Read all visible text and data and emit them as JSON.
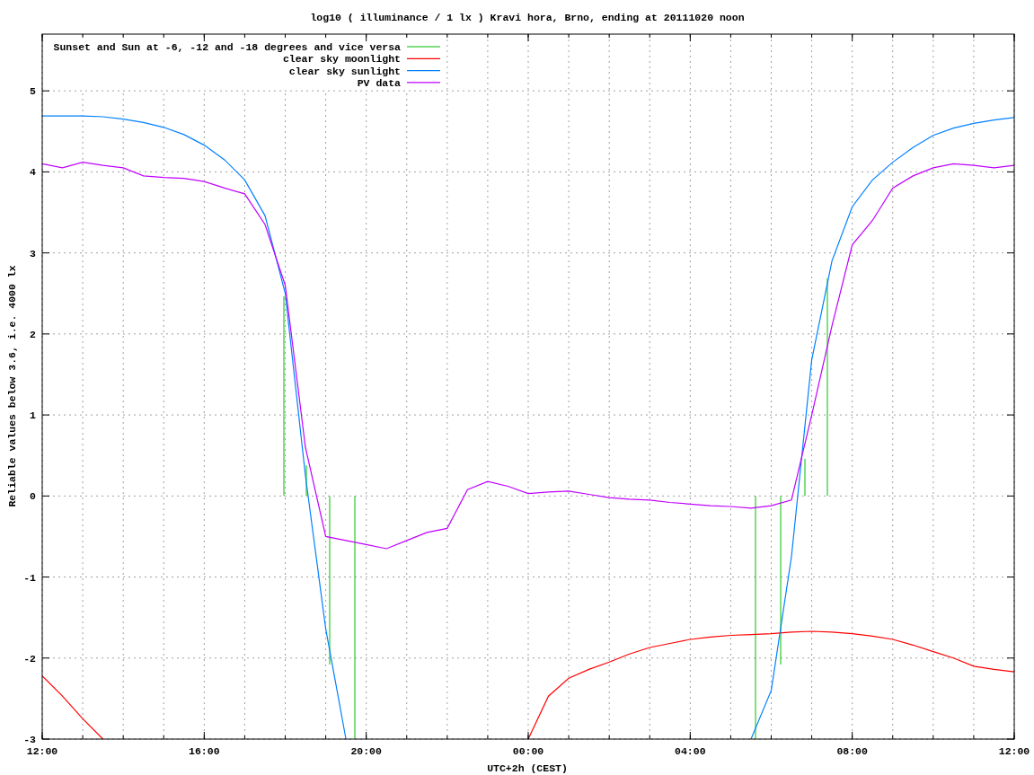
{
  "chart_data": {
    "type": "line",
    "title": "log10 ( illuminance / 1 lx ) Kravi hora, Brno, ending at 20111020 noon",
    "xlabel": "UTC+2h (CEST)",
    "ylabel": "Reliable values below 3.6, i.e. 4000 lx",
    "ylim": [
      -3,
      5.7
    ],
    "grid": true,
    "legend": true,
    "yticks": [
      {
        "value": -3,
        "label": "-3"
      },
      {
        "value": -2,
        "label": "-2"
      },
      {
        "value": -1,
        "label": "-1"
      },
      {
        "value": 0,
        "label": "0"
      },
      {
        "value": 1,
        "label": "1"
      },
      {
        "value": 2,
        "label": "2"
      },
      {
        "value": 3,
        "label": "3"
      },
      {
        "value": 4,
        "label": "4"
      },
      {
        "value": 5,
        "label": "5"
      }
    ],
    "categories": [
      "12:00",
      null,
      null,
      null,
      null,
      null,
      null,
      null,
      "16:00",
      null,
      null,
      null,
      null,
      null,
      null,
      null,
      "20:00",
      null,
      null,
      null,
      null,
      null,
      null,
      null,
      "00:00",
      null,
      null,
      null,
      null,
      null,
      null,
      null,
      "04:00",
      null,
      null,
      null,
      null,
      null,
      null,
      null,
      "08:00",
      null,
      null,
      null,
      null,
      null,
      null,
      null,
      "12:00"
    ],
    "series": [
      {
        "name": "Sunset and Sun at -6, -12 and -18 degrees and vice versa",
        "color": "#00c000",
        "values": [
          null,
          null,
          null,
          null,
          null,
          null,
          null,
          null,
          null,
          null,
          null,
          null,
          null,
          null,
          null,
          null,
          null,
          null,
          null,
          null,
          null,
          null,
          null,
          null,
          null,
          null,
          null,
          null,
          null,
          null,
          null,
          null,
          null,
          null,
          null,
          null,
          null,
          null,
          null,
          null,
          null,
          null,
          null,
          null,
          null,
          null,
          null,
          null,
          null
        ]
      },
      {
        "name": "clear sky moonlight",
        "color": "#ff0000",
        "values": [
          -2.22,
          -2.47,
          -2.75,
          -3,
          null,
          null,
          null,
          null,
          null,
          null,
          null,
          null,
          null,
          null,
          null,
          null,
          null,
          null,
          null,
          null,
          null,
          null,
          null,
          null,
          -3.0,
          -2.47,
          -2.25,
          -2.14,
          -2.05,
          -1.95,
          -1.87,
          -1.82,
          -1.77,
          -1.74,
          -1.72,
          -1.71,
          -1.7,
          -1.68,
          -1.67,
          -1.68,
          -1.7,
          -1.73,
          -1.77,
          -1.84,
          -1.92,
          -2.0,
          -2.1,
          -2.14,
          -2.17
        ]
      },
      {
        "name": "clear sky sunlight",
        "color": "#0080ff",
        "values": [
          4.69,
          4.69,
          4.69,
          4.68,
          4.65,
          4.61,
          4.55,
          4.46,
          4.33,
          4.15,
          3.9,
          3.46,
          2.5,
          0.25,
          -1.64,
          -3,
          null,
          null,
          null,
          null,
          null,
          null,
          null,
          null,
          null,
          null,
          null,
          null,
          null,
          null,
          null,
          null,
          null,
          null,
          null,
          -3,
          -2.4,
          -0.75,
          1.68,
          2.9,
          3.57,
          3.9,
          4.12,
          4.3,
          4.45,
          4.54,
          4.6,
          4.64,
          4.67
        ]
      },
      {
        "name": "PV data",
        "color": "#c000ff",
        "values": [
          4.1,
          4.05,
          4.12,
          4.08,
          4.05,
          3.95,
          3.93,
          3.92,
          3.88,
          3.8,
          3.73,
          3.35,
          2.6,
          0.6,
          -0.5,
          -0.55,
          -0.6,
          -0.65,
          -0.55,
          -0.45,
          -0.4,
          0.08,
          0.18,
          0.12,
          0.03,
          0.05,
          0.06,
          0.02,
          -0.02,
          -0.04,
          -0.05,
          -0.08,
          -0.1,
          -0.12,
          -0.13,
          -0.15,
          -0.12,
          -0.05,
          1.0,
          2.1,
          3.1,
          3.4,
          3.8,
          3.95,
          4.05,
          4.1,
          4.08,
          4.05,
          4.08
        ]
      }
    ]
  }
}
